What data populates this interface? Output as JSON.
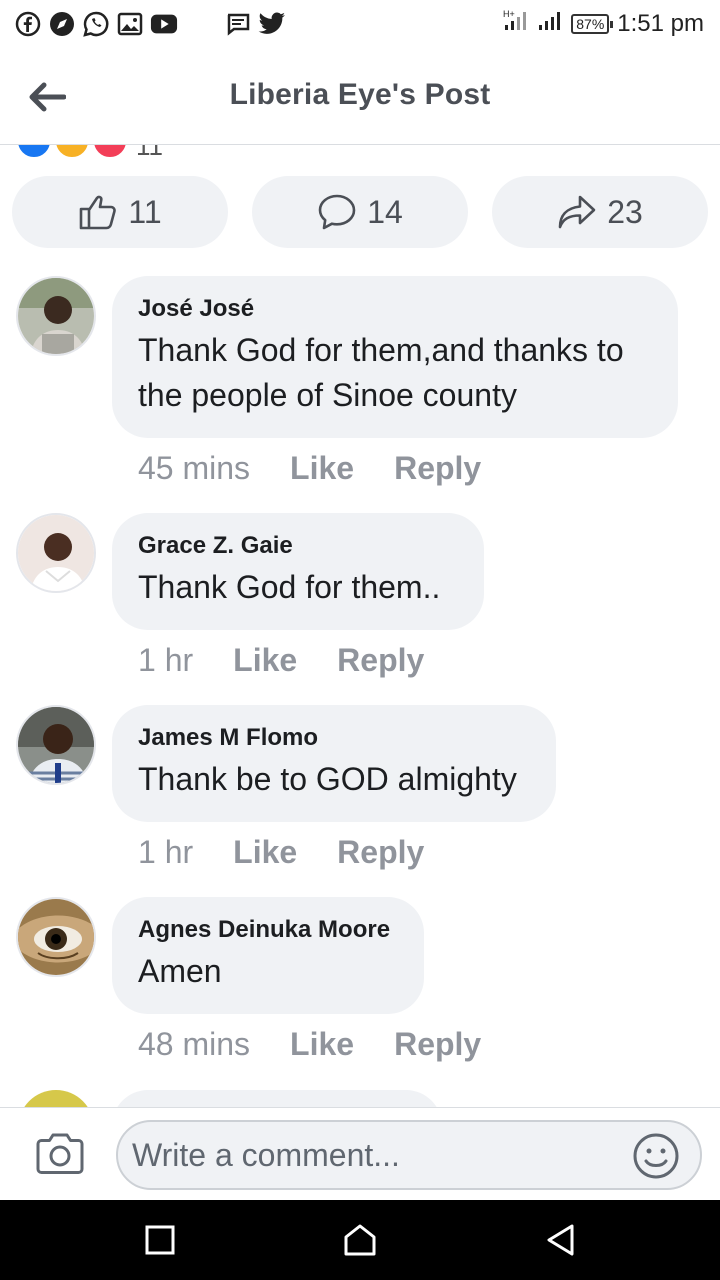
{
  "status_bar": {
    "battery": "87%",
    "time": "1:51 pm"
  },
  "header": {
    "title": "Liberia Eye's Post"
  },
  "reactions_summary": {
    "count": "11"
  },
  "actions": {
    "like_count": "11",
    "comment_count": "14",
    "share_count": "23"
  },
  "comments": [
    {
      "author": "José José",
      "text": "Thank God for them,and thanks to the people of Sinoe county",
      "time": "45 mins",
      "like_label": "Like",
      "reply_label": "Reply"
    },
    {
      "author": "Grace Z. Gaie",
      "text": "Thank God for them..",
      "time": "1 hr",
      "like_label": "Like",
      "reply_label": "Reply"
    },
    {
      "author": "James M Flomo",
      "text": "Thank be to GOD almighty",
      "time": "1 hr",
      "like_label": "Like",
      "reply_label": "Reply"
    },
    {
      "author": "Agnes Deinuka Moore",
      "text": "Amen",
      "time": "48 mins",
      "like_label": "Like",
      "reply_label": "Reply"
    }
  ],
  "composer": {
    "placeholder": "Write a comment..."
  },
  "colors": {
    "bubble_bg": "#f0f2f5",
    "meta_text": "#90949c",
    "title_text": "#4b4f56",
    "like_blue": "#1877f2"
  }
}
